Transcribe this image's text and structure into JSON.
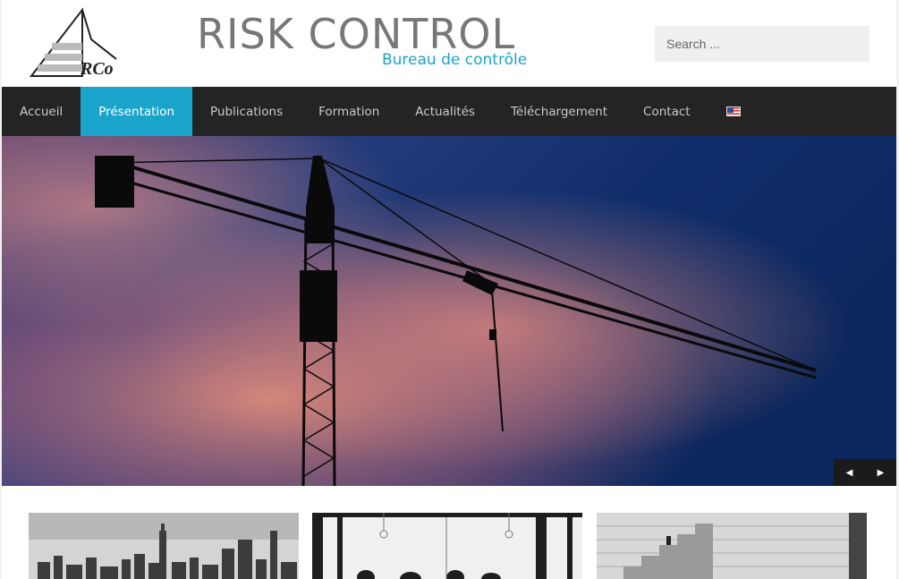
{
  "header": {
    "logo_text": "RCo",
    "title": "RISK CONTROL",
    "subtitle": "Bureau de contrôle",
    "search_placeholder": "Search ..."
  },
  "nav": {
    "items": [
      {
        "label": "Accueil",
        "active": false
      },
      {
        "label": "Présentation",
        "active": true
      },
      {
        "label": "Publications",
        "active": false
      },
      {
        "label": "Formation",
        "active": false
      },
      {
        "label": "Actualités",
        "active": false
      },
      {
        "label": "Téléchargement",
        "active": false
      },
      {
        "label": "Contact",
        "active": false
      }
    ],
    "language_flag": "us-flag-icon"
  },
  "slider": {
    "image": "crane-silhouette-sunset-sky",
    "prev_icon": "◀",
    "next_icon": "▶"
  },
  "thumbnails": [
    "city-skyline-grayscale",
    "meeting-room-grayscale",
    "staircase-grayscale"
  ],
  "colors": {
    "accent": "#1aa4cc",
    "nav_bg": "#242424",
    "title": "#777777"
  }
}
